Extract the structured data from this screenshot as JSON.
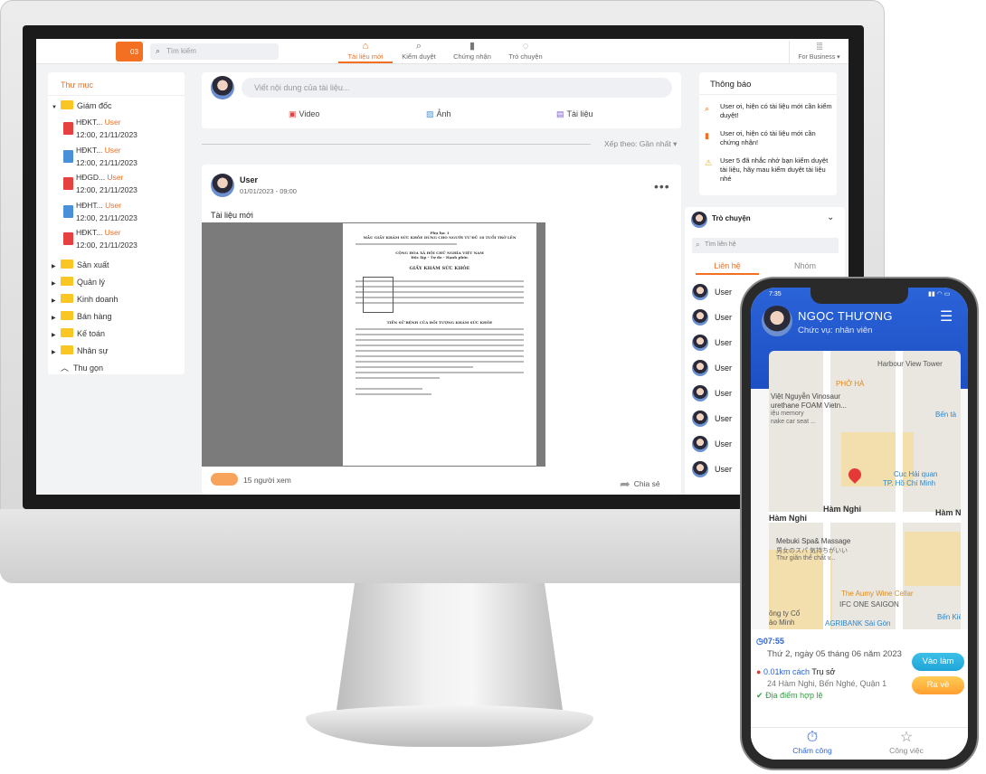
{
  "topbar": {
    "logo_badge": "03",
    "search_placeholder": "Tìm kiếm",
    "tabs": [
      {
        "label": "Tài liệu mới",
        "icon": "home-icon",
        "active": true
      },
      {
        "label": "Kiểm duyệt",
        "icon": "search-icon",
        "active": false
      },
      {
        "label": "Chứng nhận",
        "icon": "bookmark-icon",
        "active": false
      },
      {
        "label": "Trò chuyện",
        "icon": "chat-icon",
        "active": false
      }
    ],
    "business_label": "For Business ▾"
  },
  "folders": {
    "title": "Thư mục",
    "open_folder": "Giám đốc",
    "files": [
      {
        "name": "HĐKT...",
        "user": "User",
        "time": "12:00, 21/11/2023",
        "type": "pdf"
      },
      {
        "name": "HĐKT...",
        "user": "User",
        "time": "12:00, 21/11/2023",
        "type": "doc"
      },
      {
        "name": "HĐGD...",
        "user": "User",
        "time": "12:00, 21/11/2023",
        "type": "pdf"
      },
      {
        "name": "HĐHT...",
        "user": "User",
        "time": "12:00, 21/11/2023",
        "type": "doc"
      },
      {
        "name": "HĐKT...",
        "user": "User",
        "time": "12:00, 21/11/2023",
        "type": "pdf"
      }
    ],
    "others": [
      "Sản xuất",
      "Quản lý",
      "Kinh doanh",
      "Bán hàng",
      "Kế toán",
      "Nhân sự"
    ],
    "collapse_label": "Thu gọn"
  },
  "composer": {
    "placeholder": "Viết nội dung của tài liệu...",
    "video": "Video",
    "image": "Ảnh",
    "document": "Tài liệu"
  },
  "sort_label": "Xếp theo: Gần nhất ▾",
  "post": {
    "user": "User",
    "date": "01/01/2023 - 09:00",
    "caption": "Tài liệu mới",
    "doc_lines": [
      "Phụ lục 1",
      "MẪU GIẤY KHÁM SỨC KHỎE DÙNG CHO NGƯỜI TỪ ĐỦ 18 TUỔI TRỞ LÊN",
      "CỘNG HÒA XÃ HỘI CHỦ NGHĨA VIỆT NAM",
      "Độc lập - Tự do - Hạnh phúc",
      "GIẤY KHÁM SỨC KHỎE",
      "TIỀN SỬ BỆNH CỦA ĐỐI TƯỢNG KHÁM SỨC KHỎE"
    ],
    "viewers": "15 người xem",
    "share": "Chia sẻ"
  },
  "notifications": {
    "title": "Thông báo",
    "items": [
      "User ơi, hiện có tài liệu mới cần kiểm duyệt!",
      "User ơi, hiện có tài liệu mới cần chứng nhận!",
      "User 5 đã nhắc nhở bạn kiểm duyệt tài liệu, hãy mau kiểm duyệt tài liệu nhé"
    ]
  },
  "chat": {
    "title": "Trò chuyện",
    "search_placeholder": "Tìm liên hệ",
    "tab_contacts": "Liên hệ",
    "tab_groups": "Nhóm",
    "contacts": [
      "User",
      "User",
      "User",
      "User",
      "User",
      "User",
      "User",
      "User"
    ]
  },
  "phone": {
    "time": "7:35",
    "name": "NGỌC THƯƠNG",
    "role": "Chức vụ: nhân viên",
    "map_labels": [
      "Harbour View Tower",
      "PHỞ HÀ",
      "Việt Nguyễn Vinosaur",
      "urethane FOAM Vietn...",
      "iệu memory",
      "nake car seat ...",
      "Bến tà",
      "Cục Hải quan",
      "TP. Hồ Chí Minh",
      "Hàm Nghi",
      "Hàm Nghi",
      "Hàm N",
      "Mebuki Spa& Massage",
      "男女のスパ 気持ちがいい",
      "Thư giãn thể chất v...",
      "The Aumy Wine Cellar",
      "IFC ONE SAIGON",
      "ông ty Cổ",
      "ào Minh",
      "AGRIBANK Sài Gòn",
      "Bến Kiế"
    ],
    "clock": "07:55",
    "date": "Thứ 2, ngày 05 tháng 06 năm 2023",
    "distance": "0.01km cách",
    "office": "Trụ sở",
    "address": "24 Hàm Nghi, Bến Nghé, Quận 1",
    "valid": "Địa điểm hợp lệ",
    "checkin": "Vào làm",
    "checkout": "Ra về",
    "nav_timekeeping": "Chấm công",
    "nav_work": "Công việc"
  },
  "colors": {
    "accent": "#f36f21",
    "phone_primary": "#2b63d8"
  }
}
